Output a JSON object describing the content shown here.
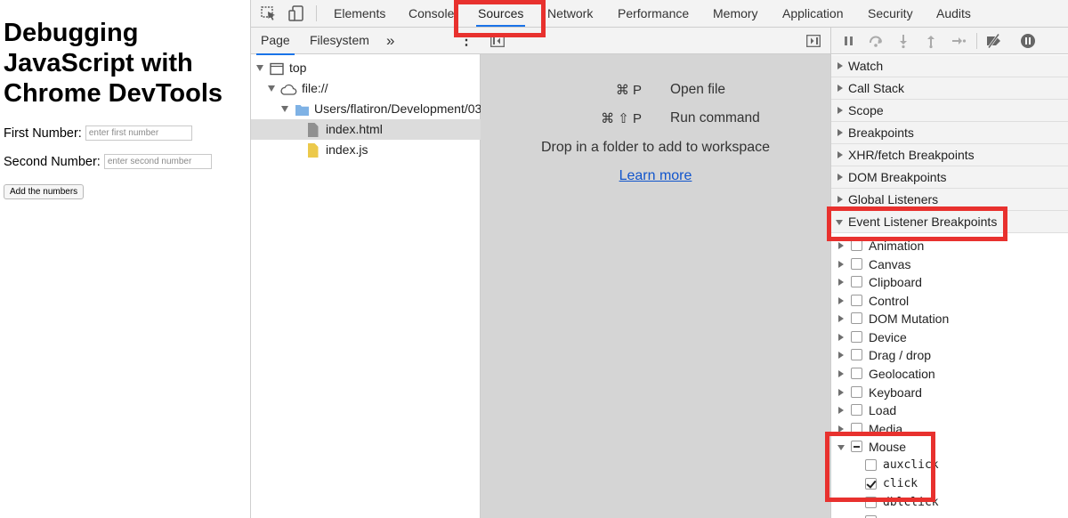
{
  "page": {
    "title": "Debugging JavaScript with Chrome DevTools",
    "first_label": "First Number:",
    "first_placeholder": "enter first number",
    "second_label": "Second Number:",
    "second_placeholder": "enter second number",
    "add_button": "Add the numbers"
  },
  "devtools": {
    "tabs": [
      "Elements",
      "Console",
      "Sources",
      "Network",
      "Performance",
      "Memory",
      "Application",
      "Security",
      "Audits"
    ],
    "active_tab": "Sources",
    "navigator": {
      "tabs": [
        "Page",
        "Filesystem"
      ],
      "more": "»",
      "menu": "⋮",
      "tree": [
        {
          "label": "top"
        },
        {
          "label": "file://"
        },
        {
          "label": "Users/flatiron/Development/03"
        },
        {
          "label": "index.html"
        },
        {
          "label": "index.js"
        }
      ]
    },
    "editor": {
      "shortcuts": [
        {
          "keys": "⌘ P",
          "label": "Open file"
        },
        {
          "keys": "⌘ ⇧ P",
          "label": "Run command"
        }
      ],
      "drop_text": "Drop in a folder to add to workspace",
      "learn_more": "Learn more"
    },
    "sidebar": {
      "sections": [
        "Watch",
        "Call Stack",
        "Scope",
        "Breakpoints",
        "XHR/fetch Breakpoints",
        "DOM Breakpoints",
        "Global Listeners",
        "Event Listener Breakpoints"
      ],
      "event_categories": [
        "Animation",
        "Canvas",
        "Clipboard",
        "Control",
        "DOM Mutation",
        "Device",
        "Drag / drop",
        "Geolocation",
        "Keyboard",
        "Load",
        "Media",
        "Mouse"
      ],
      "mouse_events": [
        {
          "label": "auxclick",
          "checked": false
        },
        {
          "label": "click",
          "checked": true
        },
        {
          "label": "dblclick",
          "checked": false
        }
      ]
    },
    "colors": {
      "highlight": "#e8312e",
      "accent": "#1a73e8",
      "panel_bg": "#f3f3f3",
      "editor_bg": "#d5d5d5"
    }
  }
}
